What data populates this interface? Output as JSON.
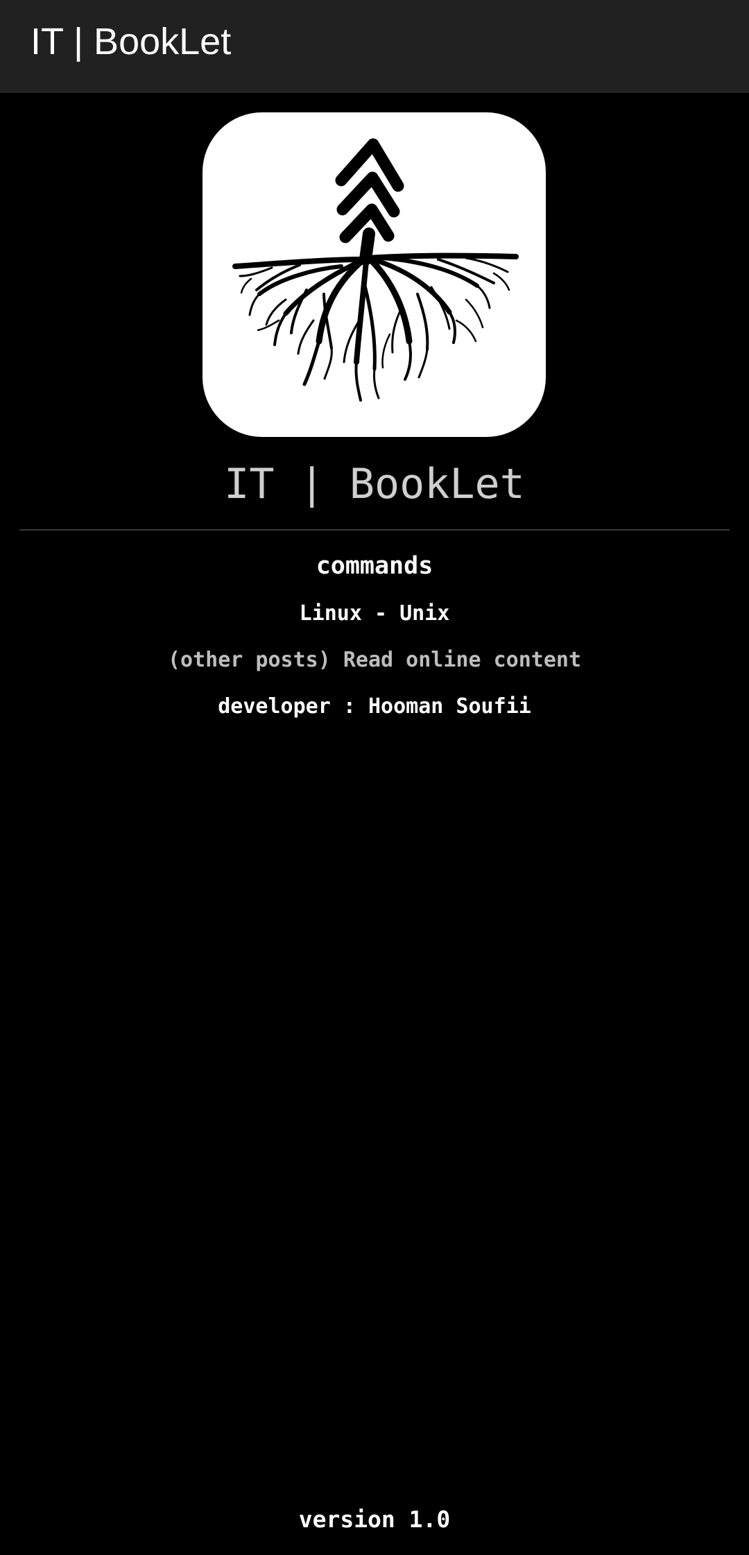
{
  "appbar": {
    "title": "IT | BookLet"
  },
  "logo": {
    "icon": "tree-roots-arrow-icon",
    "background": "#ffffff",
    "foreground": "#000000"
  },
  "main": {
    "app_name": "IT | BookLet",
    "menu": [
      {
        "label": "commands"
      },
      {
        "label": "Linux - Unix"
      },
      {
        "label": "(other posts) Read online content"
      },
      {
        "label": "developer : Hooman Soufii"
      }
    ]
  },
  "footer": {
    "version": "version 1.0"
  },
  "colors": {
    "appbar_bg": "#212121",
    "page_bg": "#000000",
    "primary_text": "#ffffff",
    "app_name_text": "#cfcfcf",
    "secondary_text": "#bdbdbd",
    "divider": "#3a3a3a"
  }
}
